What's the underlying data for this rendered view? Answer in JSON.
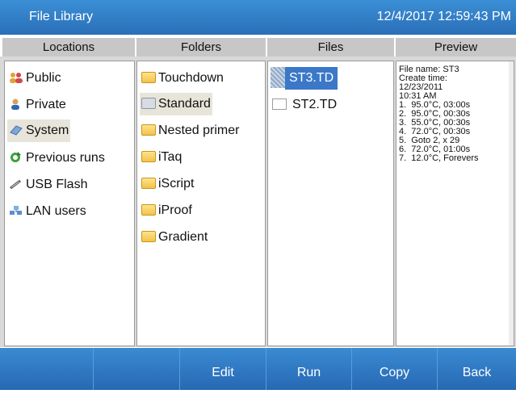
{
  "window": {
    "title": "File Library",
    "datetime": "12/4/2017 12:59:43 PM"
  },
  "columns": {
    "locations": "Locations",
    "folders": "Folders",
    "files": "Files",
    "preview": "Preview"
  },
  "locations": [
    {
      "label": "Public",
      "icon": "users-icon"
    },
    {
      "label": "Private",
      "icon": "user-icon"
    },
    {
      "label": "System",
      "icon": "system-icon",
      "selected": true
    },
    {
      "label": "Previous runs",
      "icon": "refresh-icon"
    },
    {
      "label": "USB Flash",
      "icon": "usb-icon"
    },
    {
      "label": "LAN users",
      "icon": "network-icon"
    }
  ],
  "folders": [
    {
      "label": "Touchdown"
    },
    {
      "label": "Standard",
      "selected": true
    },
    {
      "label": "Nested primer"
    },
    {
      "label": "iTaq"
    },
    {
      "label": "iScript"
    },
    {
      "label": "iProof"
    },
    {
      "label": "Gradient"
    }
  ],
  "files": [
    {
      "label": "ST3.TD",
      "selected": true
    },
    {
      "label": "ST2.TD"
    }
  ],
  "preview": {
    "lines": [
      "File name: ST3",
      "Create time:",
      "12/23/2011",
      "10:31 AM",
      "1.  95.0°C, 03:00s",
      "2.  95.0°C, 00:30s",
      "3.  55.0°C, 00:30s",
      "4.  72.0°C, 00:30s",
      "5.  Goto 2, x 29",
      "6.  72.0°C, 01:00s",
      "7.  12.0°C, Forevers"
    ]
  },
  "buttons": {
    "b1": "",
    "b2": "",
    "edit": "Edit",
    "run": "Run",
    "copy": "Copy",
    "back": "Back"
  }
}
